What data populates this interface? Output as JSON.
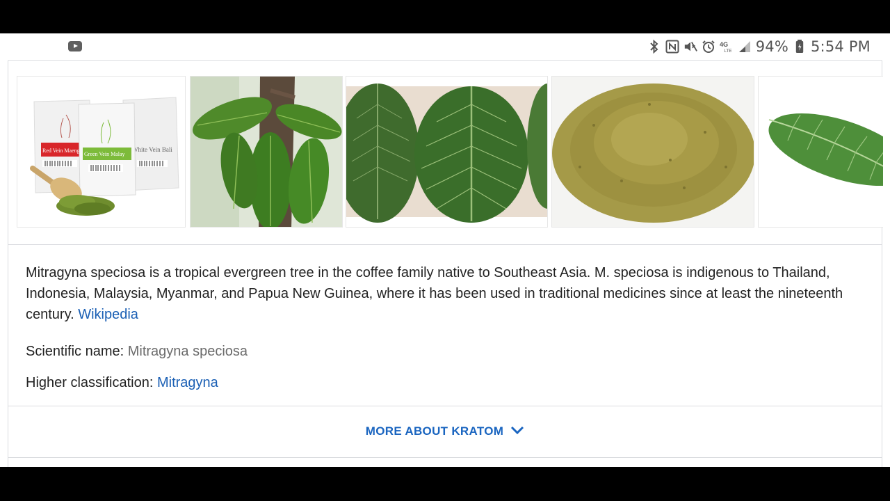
{
  "status_bar": {
    "left_icon": "youtube-icon",
    "icons": [
      "bluetooth-icon",
      "nfc-icon",
      "mute-icon",
      "alarm-icon",
      "lte-icon",
      "signal-icon"
    ],
    "network_label": "4G",
    "battery_percent": "94%",
    "time": "5:54 PM"
  },
  "images": [
    {
      "name": "kratom-product-bags",
      "labels": [
        "Red Vein Maeng Da",
        "Green Vein Malay",
        "White Vein Bali"
      ]
    },
    {
      "name": "kratom-tree-leaves"
    },
    {
      "name": "kratom-leaves-closeup"
    },
    {
      "name": "kratom-powder-pile"
    },
    {
      "name": "kratom-single-leaf"
    }
  ],
  "description": {
    "text": "Mitragyna speciosa is a tropical evergreen tree in the coffee family native to Southeast Asia. M. speciosa is indigenous to Thailand, Indonesia, Malaysia, Myanmar, and Papua New Guinea, where it has been used in traditional medicines since at least the nineteenth century.",
    "source_link": "Wikipedia"
  },
  "facts": {
    "scientific_name_label": "Scientific name:",
    "scientific_name_value": "Mitragyna speciosa",
    "higher_class_label": "Higher classification:",
    "higher_class_value": "Mitragyna"
  },
  "more_button": {
    "label": "MORE ABOUT KRATOM",
    "icon": "chevron-down-icon"
  },
  "colors": {
    "link": "#1a5fb4",
    "more_button": "#1a65c0"
  }
}
